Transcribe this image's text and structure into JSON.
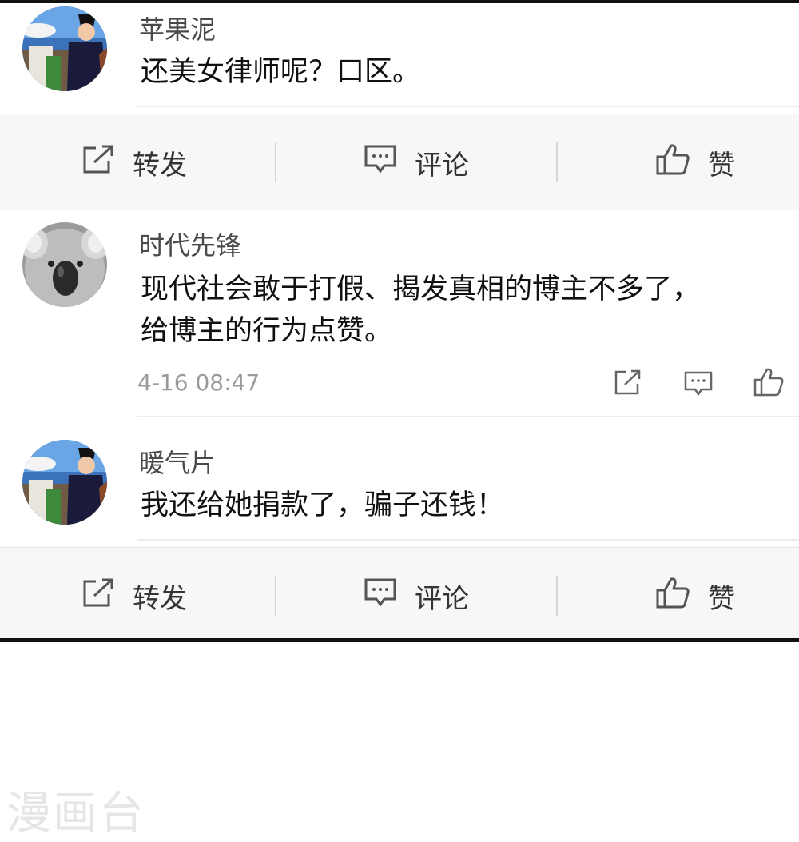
{
  "comments": [
    {
      "username": "苹果泥",
      "text": "还美女律师呢？口区。",
      "avatar": "anime-witch-avatar"
    },
    {
      "username": "时代先锋",
      "text_line1": "现代社会敢于打假、揭发真相的博主不多了，",
      "text_line2": "给博主的行为点赞。",
      "timestamp": "4-16 08:47",
      "avatar": "koala-avatar"
    },
    {
      "username": "暖气片",
      "text": "我还给她捐款了，骗子还钱！",
      "avatar": "anime-witch-avatar"
    }
  ],
  "actions": {
    "repost": "转发",
    "comment": "评论",
    "like": "赞"
  },
  "icons": {
    "repost": "share-square-icon",
    "comment": "comment-bubble-icon",
    "like": "thumbs-up-icon"
  },
  "watermark": "漫画台"
}
